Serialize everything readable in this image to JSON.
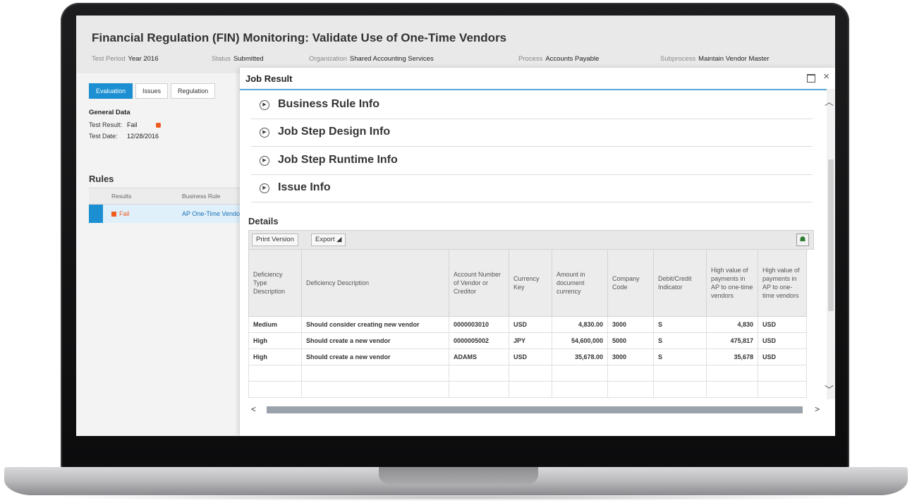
{
  "app": {
    "title": "Financial Regulation (FIN) Monitoring: Validate Use of One-Time Vendors",
    "header_fields": [
      {
        "key": "Test Period",
        "value": "Year 2016"
      },
      {
        "key": "Status",
        "value": "Submitted"
      },
      {
        "key": "Organization",
        "value": "Shared Accounting Services"
      },
      {
        "key": "Process",
        "value": "Accounts Payable"
      },
      {
        "key": "Subprocess",
        "value": "Maintain Vendor Master"
      }
    ]
  },
  "left": {
    "tabs": [
      "Evaluation",
      "Issues",
      "Regulation"
    ],
    "general_data_title": "General Data",
    "test_result_label": "Test Result:",
    "test_result_value": "Fail",
    "test_date_label": "Test Date:",
    "test_date_value": "12/28/2016",
    "rules_title": "Rules",
    "rules_columns": [
      "Results",
      "Business Rule"
    ],
    "rule_row": {
      "result": "Fail",
      "business_rule": "AP One-Time Vendo"
    }
  },
  "dialog": {
    "title": "Job Result",
    "close_glyph": "×",
    "sections": [
      "Business Rule Info",
      "Job Step Design Info",
      "Job Step Runtime Info",
      "Issue Info"
    ],
    "details_title": "Details",
    "toolbar": {
      "print_label": "Print Version",
      "export_label": "Export"
    },
    "table": {
      "columns": [
        "Deficiency Type Description",
        "Deficiency Description",
        "Account Number of Vendor or Creditor",
        "Currency Key",
        "Amount in document currency",
        "Company Code",
        "Debit/Credit Indicator",
        "High value of payments in AP to one-time vendors",
        "High value of payments in AP to one-time vendors"
      ],
      "rows": [
        [
          "Medium",
          "Should consider creating new vendor",
          "0000003010",
          "USD",
          "4,830.00",
          "3000",
          "S",
          "4,830",
          "USD"
        ],
        [
          "High",
          "Should create a new vendor",
          "0000005002",
          "JPY",
          "54,600,000",
          "5000",
          "S",
          "475,817",
          "USD"
        ],
        [
          "High",
          "Should create a new vendor",
          "ADAMS",
          "USD",
          "35,678.00",
          "3000",
          "S",
          "35,678",
          "USD"
        ]
      ]
    }
  },
  "colors": {
    "accent": "#1b8fd2",
    "fail": "#f05b1f"
  }
}
